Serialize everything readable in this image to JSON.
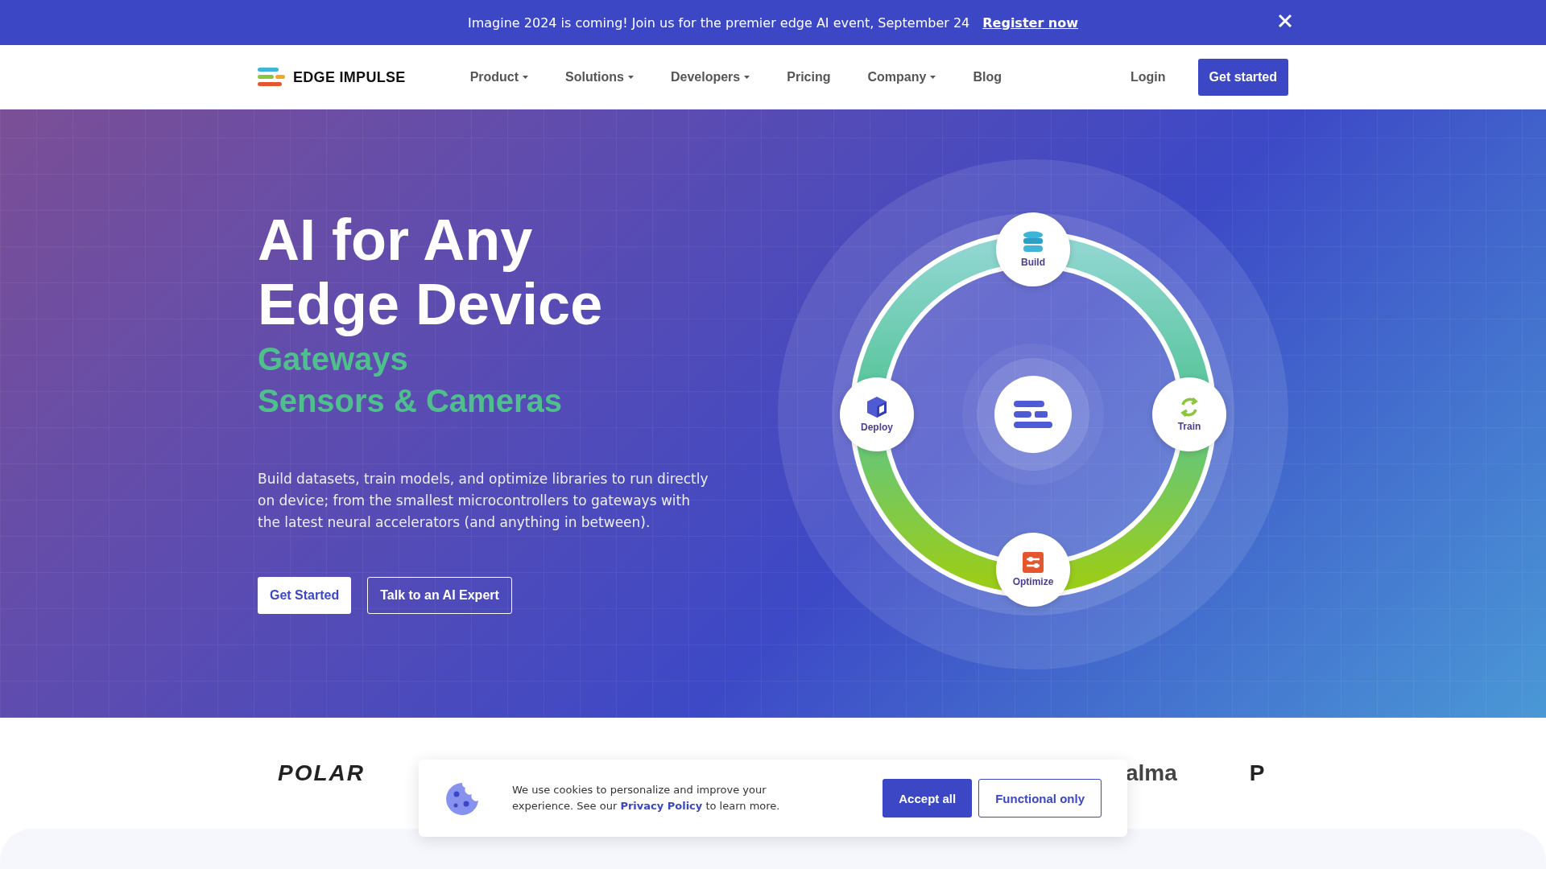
{
  "banner": {
    "text": "Imagine 2024 is coming! Join us for the premier edge AI event, September 24",
    "link": "Register now"
  },
  "nav": {
    "logo": "EDGE IMPULSE",
    "items": [
      {
        "label": "Product",
        "dropdown": true
      },
      {
        "label": "Solutions",
        "dropdown": true
      },
      {
        "label": "Developers",
        "dropdown": true
      },
      {
        "label": "Pricing",
        "dropdown": false
      },
      {
        "label": "Company",
        "dropdown": true
      },
      {
        "label": "Blog",
        "dropdown": false
      }
    ],
    "login": "Login",
    "cta": "Get started"
  },
  "hero": {
    "title_lines": [
      "AI for Any",
      "Edge Device"
    ],
    "rotating_words": [
      "Gateways",
      "Sensors & Cameras"
    ],
    "description": "Build datasets, train models, and optimize libraries to run directly on device; from the smallest microcontrollers to gateways with the latest neural accelerators (and anything in between).",
    "buttons": [
      {
        "label": "Get Started",
        "kind": "solid"
      },
      {
        "label": "Talk to an AI Expert",
        "kind": "outline"
      }
    ]
  },
  "diagram": {
    "steps": [
      {
        "label": "Build",
        "kind": "database"
      },
      {
        "label": "Train",
        "kind": "cycle"
      },
      {
        "label": "Optimize",
        "kind": "sliders"
      },
      {
        "label": "Deploy",
        "kind": "cube"
      }
    ]
  },
  "logos": [
    {
      "text": "POLAR",
      "kind": "polar"
    },
    {
      "text": "alma",
      "kind": "plain"
    },
    {
      "text": "P",
      "kind": "partial"
    }
  ],
  "cookie": {
    "text_before": "We use cookies to personalize and improve your experience. See our",
    "link": "Privacy Policy",
    "text_after": "to learn more.",
    "buttons": [
      {
        "label": "Accept all",
        "kind": "solid"
      },
      {
        "label": "Functional only",
        "kind": "outline"
      }
    ]
  }
}
